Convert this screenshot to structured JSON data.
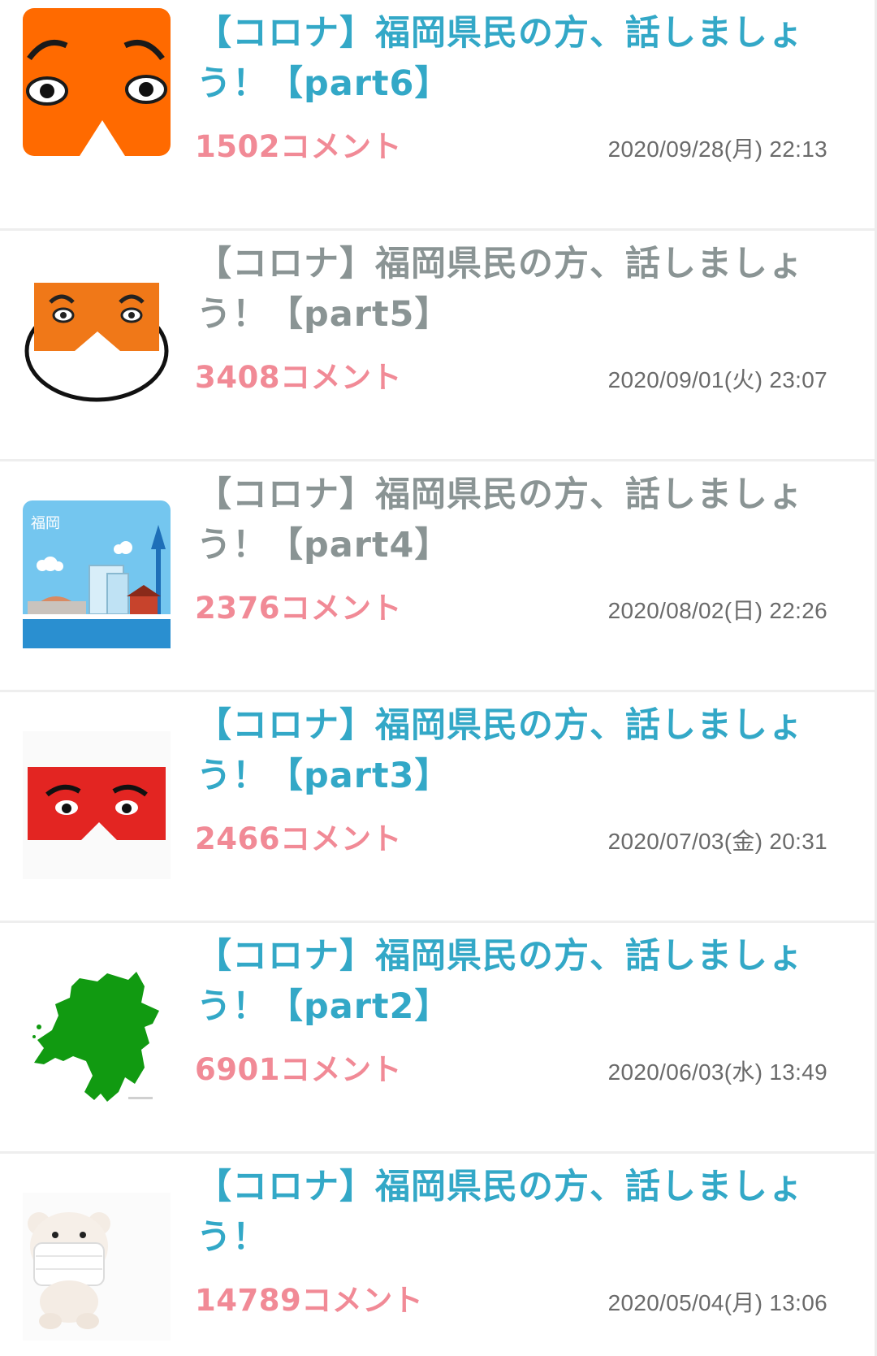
{
  "threads": [
    {
      "title": "【コロナ】福岡県民の方、話しましょう！【part6】",
      "comments": "1502コメント",
      "date": "2020/09/28(月) 22:13",
      "read": false,
      "thumbnail": "orange-face-icon"
    },
    {
      "title": "【コロナ】福岡県民の方、話しましょう！【part5】",
      "comments": "3408コメント",
      "date": "2020/09/01(火) 23:07",
      "read": true,
      "thumbnail": "orange-face-mask-icon"
    },
    {
      "title": "【コロナ】福岡県民の方、話しましょう！【part4】",
      "comments": "2376コメント",
      "date": "2020/08/02(日) 22:26",
      "read": true,
      "thumbnail": "fukuoka-city-illustration",
      "thumbnail_text": "福岡"
    },
    {
      "title": "【コロナ】福岡県民の方、話しましょう！【part3】",
      "comments": "2466コメント",
      "date": "2020/07/03(金) 20:31",
      "read": false,
      "thumbnail": "red-face-icon"
    },
    {
      "title": "【コロナ】福岡県民の方、話しましょう！【part2】",
      "comments": "6901コメント",
      "date": "2020/06/03(水) 13:49",
      "read": false,
      "thumbnail": "fukuoka-map-icon"
    },
    {
      "title": "【コロナ】福岡県民の方、話しましょう！",
      "comments": "14789コメント",
      "date": "2020/05/04(月) 13:06",
      "read": false,
      "thumbnail": "bear-with-mask-icon"
    }
  ],
  "colors": {
    "title_unread": "#33a8c7",
    "title_read": "#8a9494",
    "comments": "#f18a96",
    "date": "#6a6a6a",
    "divider": "#eeeeee"
  }
}
